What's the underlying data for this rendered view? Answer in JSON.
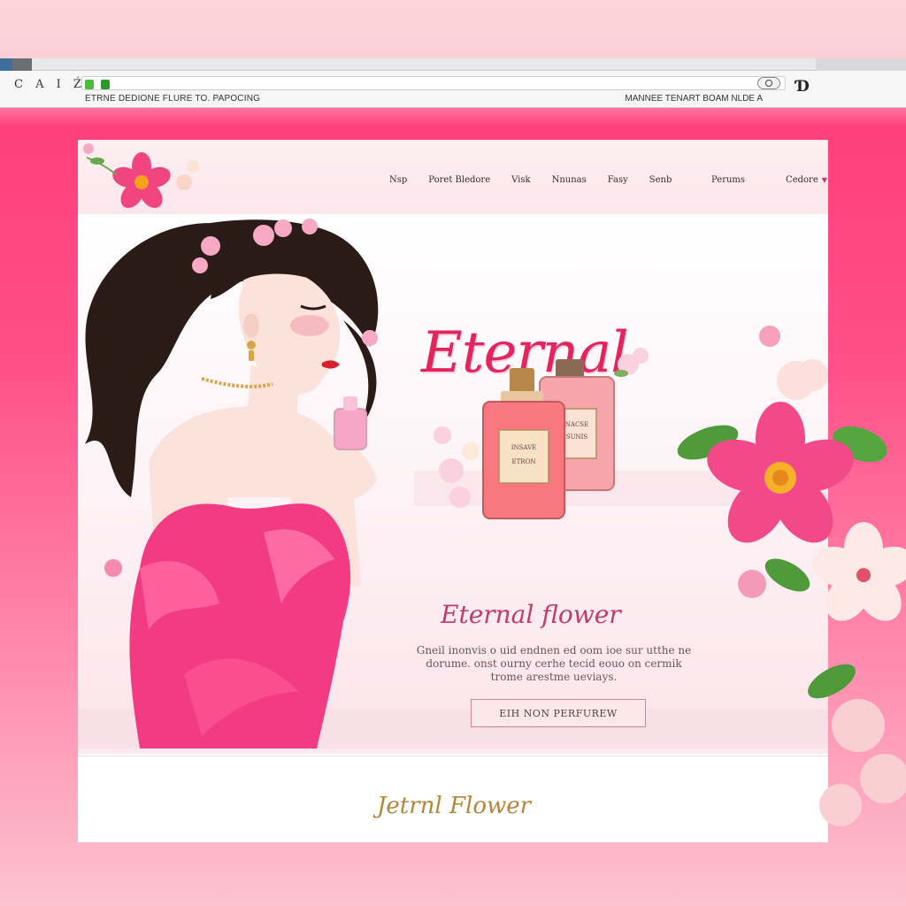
{
  "browser": {
    "nav_glyphs": "C A I Ź",
    "page_title": "ETRNE DEDIONE FLURE TO. PAPOCING",
    "page_title_right": "MANNEE TENART BOAM NLDE A",
    "logo_text": "Ɗ"
  },
  "site": {
    "nav": {
      "links": [
        "Nsp",
        "Poret Bledore",
        "Visk",
        "Nnunas",
        "Fasy",
        "Senb"
      ],
      "right_links": [
        "Perums",
        "Cedore"
      ]
    },
    "hero": {
      "brand_title": "Eternal",
      "subtitle": "Eternal flower",
      "description": "Gneil inonvis o uid endnen ed oom ioe sur utthe ne dorume. onst ourny cerhe tecid eouo on cermik trome arestme ueviays.",
      "cta_label": "EIH NON PERFUREW",
      "bottle_label_1": "INSAVE\nETRON",
      "bottle_label_2": "NACSE\nSUNIS"
    },
    "footer": {
      "title": "Jetrnl Flower"
    }
  },
  "colors": {
    "accent": "#e2245f",
    "gold": "#b6853a",
    "pink_bg": "#ff3f7d"
  }
}
